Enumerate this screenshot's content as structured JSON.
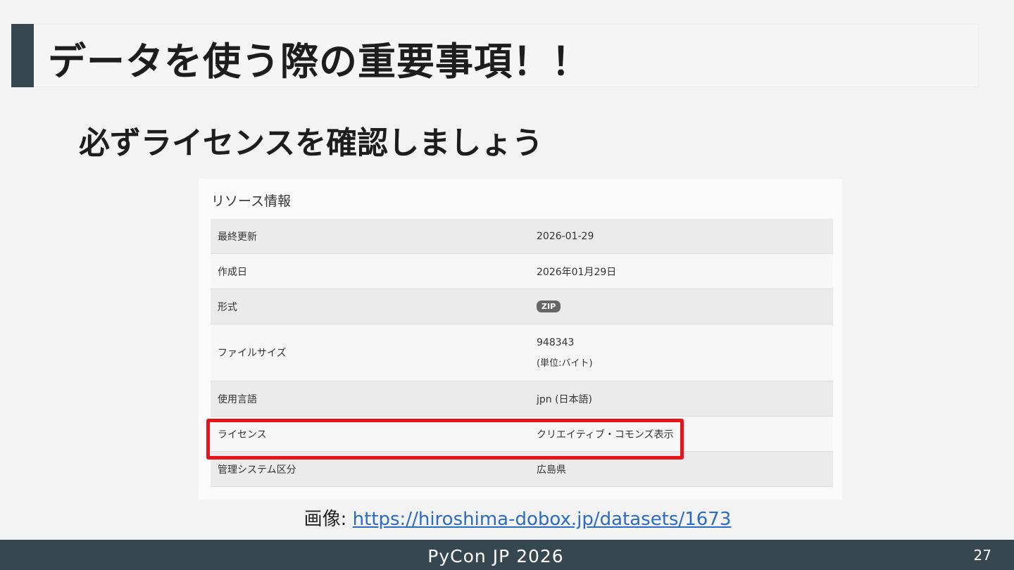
{
  "slide": {
    "title": "データを使う際の重要事項！！",
    "subtitle": "必ずライセンスを確認しましょう"
  },
  "resource_panel": {
    "heading": "リソース情報",
    "rows": [
      {
        "key": "最終更新",
        "value": "2026-01-29"
      },
      {
        "key": "作成日",
        "value": "2026年01月29日"
      },
      {
        "key": "形式",
        "value": "ZIP"
      },
      {
        "key": "ファイルサイズ",
        "value": "948343",
        "unit": "(単位:バイト)"
      },
      {
        "key": "使用言語",
        "value": "jpn (日本語)"
      },
      {
        "key": "ライセンス",
        "value": "クリエイティブ・コモンズ表示"
      },
      {
        "key": "管理システム区分",
        "value": "広島県"
      }
    ]
  },
  "caption": {
    "prefix": "画像: ",
    "link_text": "https://hiroshima-dobox.jp/datasets/1673"
  },
  "footer": {
    "event": "PyCon JP 2026",
    "page_number": "27"
  },
  "colors": {
    "accent": "#37474f",
    "highlight": "#e5131a",
    "link": "#2b6cc4"
  }
}
